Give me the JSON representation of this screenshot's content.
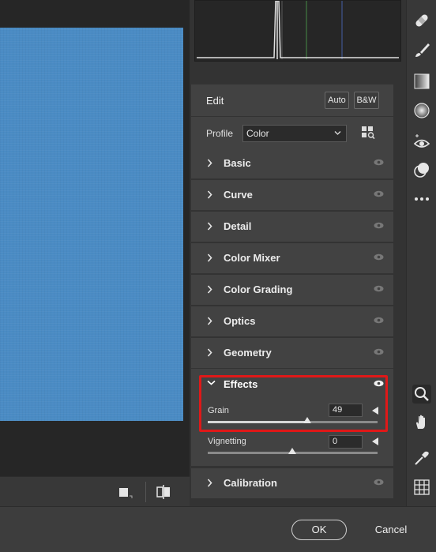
{
  "edit_panel": {
    "title": "Edit",
    "auto_label": "Auto",
    "bw_label": "B&W",
    "profile_label": "Profile",
    "profile_value": "Color"
  },
  "sections": {
    "basic": "Basic",
    "curve": "Curve",
    "detail": "Detail",
    "color_mixer": "Color Mixer",
    "color_grading": "Color Grading",
    "optics": "Optics",
    "geometry": "Geometry",
    "effects": "Effects",
    "calibration": "Calibration"
  },
  "effects": {
    "grain_label": "Grain",
    "grain_value": "49",
    "vignetting_label": "Vignetting",
    "vignetting_value": "0"
  },
  "footer": {
    "ok_label": "OK",
    "cancel_label": "Cancel"
  },
  "colors": {
    "image_fill": "#4a8bc4",
    "highlight": "#e01818",
    "panel": "#424242"
  },
  "icons": {
    "tools": [
      "healing-bandage-icon",
      "brush-icon",
      "gradient-icon",
      "radial-filter-icon",
      "red-eye-icon",
      "presets-icon",
      "more-icon",
      "zoom-icon",
      "hand-icon",
      "eyedropper-icon",
      "grid-icon"
    ]
  }
}
